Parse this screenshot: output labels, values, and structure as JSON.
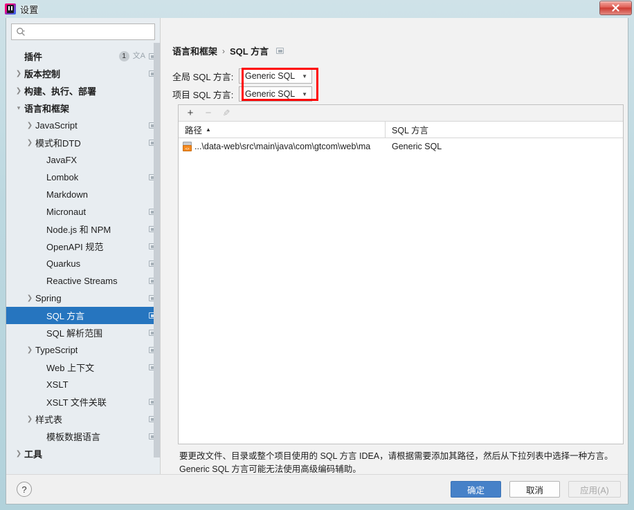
{
  "window": {
    "title": "设置",
    "app_icon": "intellij-idea-logo",
    "close_label": "✕"
  },
  "sidebar": {
    "search": {
      "value": "",
      "placeholder": "",
      "icon": "search-icon"
    },
    "items": [
      {
        "label": "",
        "clipped": true,
        "arrow": "",
        "bold": false,
        "icons": []
      },
      {
        "label": "插件",
        "indent": 10,
        "arrow": "",
        "bold": true,
        "icons": [
          "badge-1",
          "translate",
          "scope"
        ],
        "badge": "1"
      },
      {
        "label": "版本控制",
        "indent": 10,
        "arrow": "›",
        "bold": true,
        "icons": [
          "scope"
        ]
      },
      {
        "label": "构建、执行、部署",
        "indent": 10,
        "arrow": "›",
        "bold": true,
        "icons": []
      },
      {
        "label": "语言和框架",
        "indent": 10,
        "arrow": "⌄",
        "bold": true,
        "icons": []
      },
      {
        "label": "JavaScript",
        "indent": 26,
        "arrow": "›",
        "bold": false,
        "icons": [
          "scope"
        ]
      },
      {
        "label": "模式和DTD",
        "indent": 26,
        "arrow": "›",
        "bold": false,
        "icons": [
          "scope"
        ]
      },
      {
        "label": "JavaFX",
        "indent": 42,
        "arrow": "",
        "bold": false,
        "icons": []
      },
      {
        "label": "Lombok",
        "indent": 42,
        "arrow": "",
        "bold": false,
        "icons": [
          "scope"
        ]
      },
      {
        "label": "Markdown",
        "indent": 42,
        "arrow": "",
        "bold": false,
        "icons": []
      },
      {
        "label": "Micronaut",
        "indent": 42,
        "arrow": "",
        "bold": false,
        "icons": [
          "scope"
        ]
      },
      {
        "label": "Node.js 和 NPM",
        "indent": 42,
        "arrow": "",
        "bold": false,
        "icons": [
          "scope"
        ]
      },
      {
        "label": "OpenAPI 规范",
        "indent": 42,
        "arrow": "",
        "bold": false,
        "icons": [
          "scope"
        ]
      },
      {
        "label": "Quarkus",
        "indent": 42,
        "arrow": "",
        "bold": false,
        "icons": [
          "scope"
        ]
      },
      {
        "label": "Reactive Streams",
        "indent": 42,
        "arrow": "",
        "bold": false,
        "icons": [
          "scope"
        ]
      },
      {
        "label": "Spring",
        "indent": 26,
        "arrow": "›",
        "bold": false,
        "icons": [
          "scope"
        ]
      },
      {
        "label": "SQL 方言",
        "indent": 42,
        "arrow": "",
        "bold": false,
        "icons": [
          "scope"
        ],
        "selected": true
      },
      {
        "label": "SQL 解析范围",
        "indent": 42,
        "arrow": "",
        "bold": false,
        "icons": [
          "scope"
        ]
      },
      {
        "label": "TypeScript",
        "indent": 26,
        "arrow": "›",
        "bold": false,
        "icons": [
          "scope"
        ]
      },
      {
        "label": "Web 上下文",
        "indent": 42,
        "arrow": "",
        "bold": false,
        "icons": [
          "scope"
        ]
      },
      {
        "label": "XSLT",
        "indent": 42,
        "arrow": "",
        "bold": false,
        "icons": []
      },
      {
        "label": "XSLT 文件关联",
        "indent": 42,
        "arrow": "",
        "bold": false,
        "icons": [
          "scope"
        ]
      },
      {
        "label": "样式表",
        "indent": 26,
        "arrow": "›",
        "bold": false,
        "icons": [
          "scope"
        ]
      },
      {
        "label": "模板数据语言",
        "indent": 42,
        "arrow": "",
        "bold": false,
        "icons": [
          "scope"
        ]
      },
      {
        "label": "工具",
        "indent": 10,
        "arrow": "›",
        "bold": true,
        "icons": []
      }
    ]
  },
  "main": {
    "breadcrumb": {
      "parent": "语言和框架",
      "separator": "›",
      "current": "SQL 方言",
      "icon": "scope-icon"
    },
    "fields": [
      {
        "label": "全局 SQL 方言:",
        "value": "Generic SQL",
        "caret": "▼"
      },
      {
        "label": "项目 SQL 方言:",
        "value": "Generic SQL",
        "caret": "▼"
      }
    ],
    "highlight_color": "#ff0000",
    "toolbar": [
      {
        "name": "add-button",
        "glyph": "+",
        "enabled": true
      },
      {
        "name": "remove-button",
        "glyph": "−",
        "enabled": false
      },
      {
        "name": "edit-button",
        "glyph": "✎",
        "enabled": false
      }
    ],
    "table": {
      "columns": [
        {
          "label": "路径",
          "sort": "▲"
        },
        {
          "label": "SQL 方言",
          "sort": ""
        }
      ],
      "rows": [
        {
          "icon": "xml-file-icon",
          "path": "...\\data-web\\src\\main\\java\\com\\gtcom\\web\\ma",
          "dialect": "Generic SQL"
        }
      ]
    },
    "description": "要更改文件、目录或整个项目使用的 SQL 方言 IDEA，请根据需要添加其路径，然后从下拉列表中选择一种方言。Generic SQL 方言可能无法使用高级编码辅助。"
  },
  "footer": {
    "help": "?",
    "ok": "确定",
    "cancel": "取消",
    "apply": "应用(A)"
  }
}
